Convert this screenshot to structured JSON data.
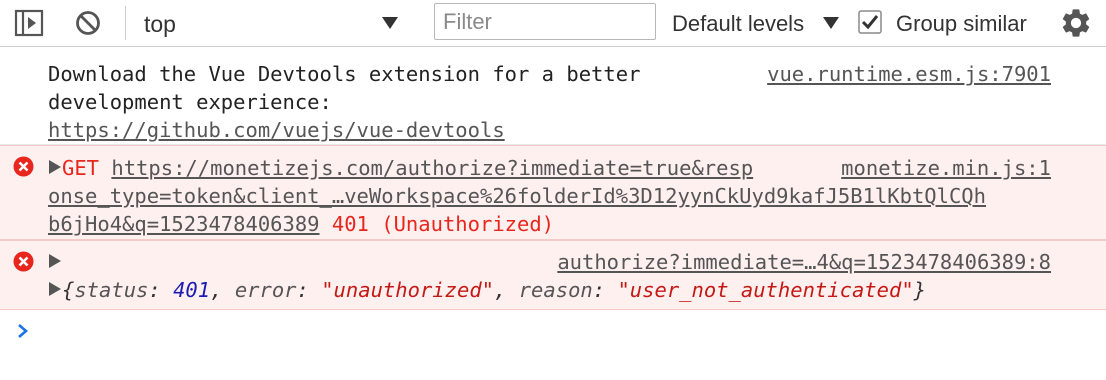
{
  "toolbar": {
    "context_value": "top",
    "filter_placeholder": "Filter",
    "filter_value": "",
    "levels_label": "Default levels",
    "group_similar_label": "Group similar",
    "group_similar_checked": true,
    "icons": [
      "sidebar-toggle-icon",
      "clear-console-icon",
      "dropdown-arrow-icon",
      "checkbox-icon",
      "gear-icon"
    ]
  },
  "messages": [
    {
      "type": "info",
      "lines": [
        "Download the Vue Devtools extension for a better",
        "development experience:"
      ],
      "url": "https://github.com/vuejs/vue-devtools",
      "source": "vue.runtime.esm.js:7901"
    },
    {
      "type": "error",
      "method": "GET",
      "url_lines": [
        "https://monetizejs.com/authorize?immediate=true&resp",
        "onse_type=token&client_…veWorkspace%26folderId%3D12yynCkUyd9kafJ5B1lKbtQlCQh",
        "b6jHo4&q=1523478406389"
      ],
      "status": "401 (Unauthorized)",
      "source": "monetize.min.js:1"
    },
    {
      "type": "error",
      "source": "authorize?immediate=…4&q=1523478406389:8",
      "object": {
        "status_key": "status",
        "status_value": "401",
        "error_key": "error",
        "error_value": "\"unauthorized\"",
        "reason_key": "reason",
        "reason_value": "\"user_not_authenticated\""
      }
    }
  ],
  "colors": {
    "error_bg": "#fff0f0",
    "error_text": "#e8261d",
    "prompt": "#1a73e8",
    "number": "#1c1cb5",
    "string": "#c41a16"
  }
}
